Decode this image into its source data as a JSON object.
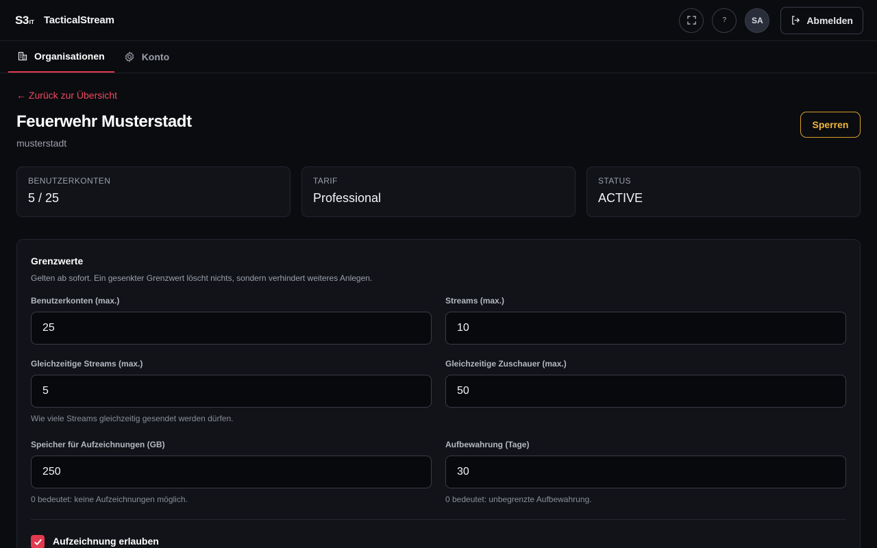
{
  "header": {
    "logo_main": "S3",
    "logo_sup": "IT",
    "app_title": "TacticalStream",
    "fullscreen_icon": "fullscreen-icon",
    "help_label": "?",
    "avatar_initials": "SA",
    "logout_label": "Abmelden"
  },
  "tabs": [
    {
      "label": "Organisationen",
      "icon": "building-icon",
      "active": true
    },
    {
      "label": "Konto",
      "icon": "gear-icon",
      "active": false
    }
  ],
  "page": {
    "back_link": "← Zurück zur Übersicht",
    "title": "Feuerwehr Musterstadt",
    "subtitle": "musterstadt",
    "lock_button": "Sperren"
  },
  "stats": [
    {
      "label": "BENUTZERKONTEN",
      "value": "5 / 25"
    },
    {
      "label": "TARIF",
      "value": "Professional"
    },
    {
      "label": "STATUS",
      "value": "ACTIVE"
    }
  ],
  "limits": {
    "title": "Grenzwerte",
    "description": "Gelten ab sofort. Ein gesenkter Grenzwert löscht nichts, sondern verhindert weiteres Anlegen.",
    "fields": [
      {
        "label": "Benutzerkonten (max.)",
        "value": "25"
      },
      {
        "label": "Streams (max.)",
        "value": "10"
      },
      {
        "label": "Gleichzeitige Streams (max.)",
        "value": "5",
        "hint": "Wie viele Streams gleichzeitig gesendet werden dürfen."
      },
      {
        "label": "Gleichzeitige Zuschauer (max.)",
        "value": "50"
      },
      {
        "label": "Speicher für Aufzeichnungen (GB)",
        "value": "250",
        "hint": "0 bedeutet: keine Aufzeichnungen möglich."
      },
      {
        "label": "Aufbewahrung (Tage)",
        "value": "30",
        "hint": "0 bedeutet: unbegrenzte Aufbewahrung."
      }
    ],
    "recording_checkbox": {
      "label": "Aufzeichnung erlauben",
      "checked": true
    }
  },
  "colors": {
    "accent": "#e23a4f",
    "warning": "#f0b53d",
    "background": "#0b0c10",
    "card": "#111318"
  }
}
